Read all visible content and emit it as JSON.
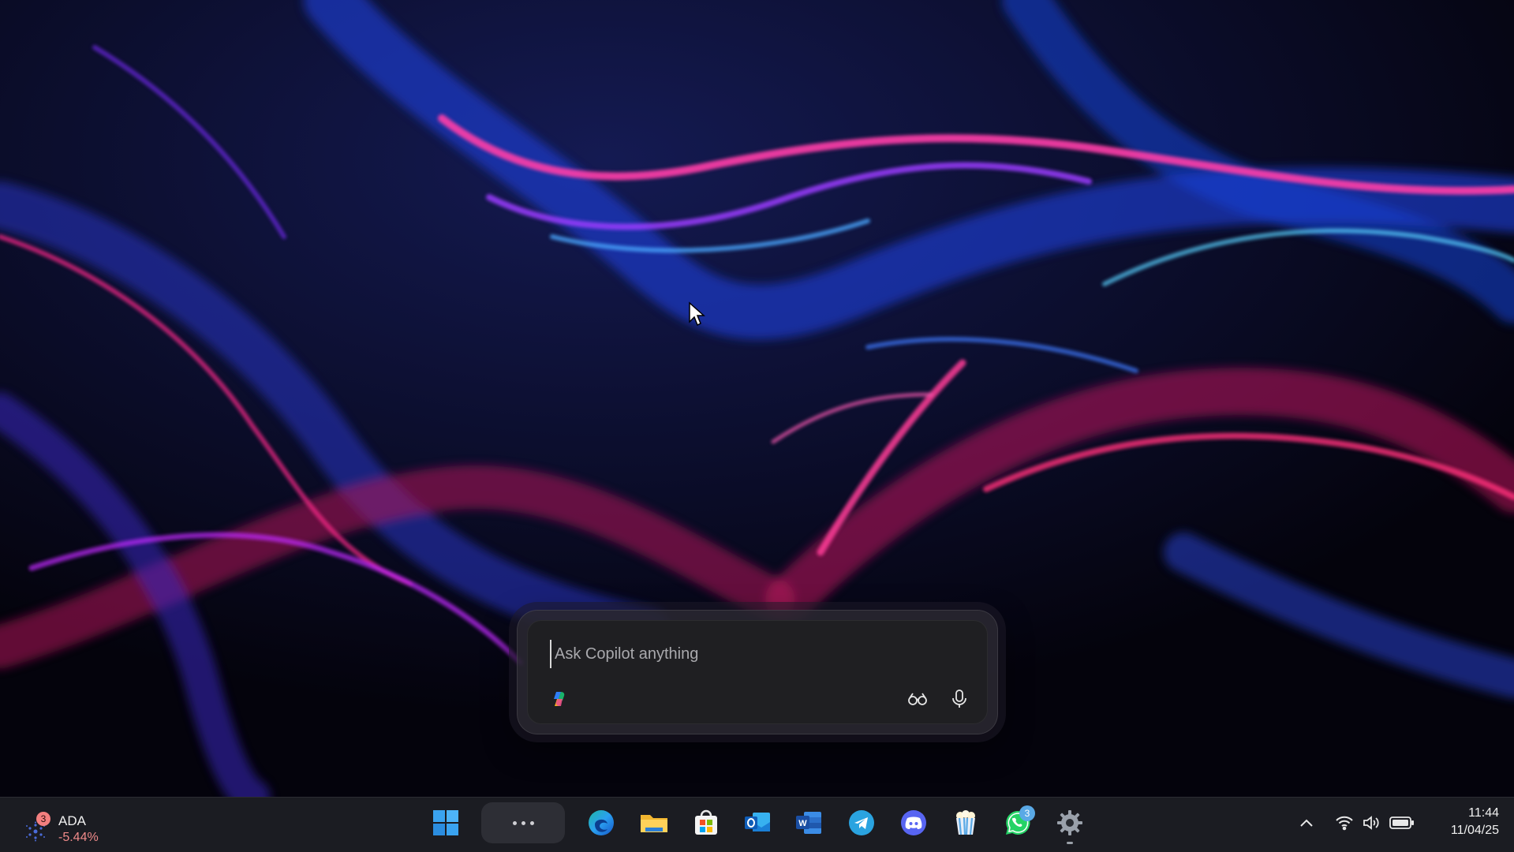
{
  "copilot": {
    "placeholder": "Ask Copilot anything",
    "value": ""
  },
  "widget": {
    "badge_count": "3",
    "symbol": "ADA",
    "change": "-5.44%"
  },
  "taskbar": {
    "pinned": [
      {
        "name": "start-button",
        "icon": "windows-logo-icon"
      },
      {
        "name": "more-button",
        "icon": "ellipsis-icon"
      },
      {
        "name": "edge-button",
        "icon": "edge-icon"
      },
      {
        "name": "file-explorer-button",
        "icon": "folder-icon"
      },
      {
        "name": "store-button",
        "icon": "store-icon"
      },
      {
        "name": "outlook-button",
        "icon": "outlook-icon"
      },
      {
        "name": "word-button",
        "icon": "word-icon"
      },
      {
        "name": "telegram-button",
        "icon": "telegram-icon"
      },
      {
        "name": "discord-button",
        "icon": "discord-icon"
      },
      {
        "name": "popcorn-app-button",
        "icon": "popcorn-icon"
      },
      {
        "name": "whatsapp-button",
        "icon": "whatsapp-icon"
      },
      {
        "name": "settings-button",
        "icon": "gear-icon"
      }
    ],
    "whatsapp_badge": "3"
  },
  "tray": {
    "icons": [
      "chevron-up-icon",
      "wifi-icon",
      "volume-icon",
      "battery-icon"
    ]
  },
  "clock": {
    "time": "11:44",
    "date": "11/04/25"
  },
  "colors": {
    "taskbar_bg": "#1b1c22",
    "copilot_bg": "#1f1f22",
    "change_negative": "#f08a8a",
    "badge_blue": "#5aa9e6"
  }
}
